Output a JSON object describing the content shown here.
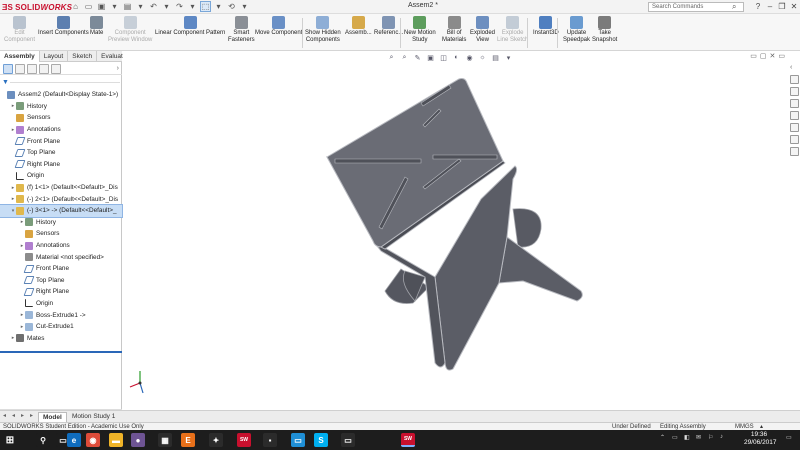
{
  "app": {
    "logo_ds": "ƎS",
    "logo_solid": "SOLID",
    "logo_works": "WORKS",
    "doc_title": "Assem2 *",
    "search_placeholder": "Search Commands",
    "window_buttons": [
      "?",
      "–",
      "❐",
      "✕"
    ]
  },
  "qat": [
    "⌂",
    "▭",
    "▣",
    "▾",
    "▤",
    "▾",
    "↶",
    "▾",
    "↷",
    "▾",
    "⬚",
    "▾",
    "⟲",
    "▾"
  ],
  "ribbon": {
    "buttons": [
      {
        "l1": "Edit",
        "l2": "Component",
        "color": "#b9c3cf",
        "dim": true
      },
      {
        "l1": "Insert Components",
        "l2": "",
        "color": "#5c7fb0",
        "dim": false
      },
      {
        "l1": "Mate",
        "l2": "",
        "color": "#7c8a99",
        "dim": false
      },
      {
        "l1": "Component",
        "l2": "Preview Window",
        "color": "#c7cfd8",
        "dim": true
      },
      {
        "l1": "Linear Component Pattern",
        "l2": "",
        "color": "#5e88c4",
        "dim": false
      },
      {
        "l1": "Smart",
        "l2": "Fasteners",
        "color": "#8a8f96",
        "dim": false
      },
      {
        "l1": "Move Component",
        "l2": "",
        "color": "#6a90c6",
        "dim": false
      },
      {
        "l1": "Show Hidden",
        "l2": "Components",
        "color": "#8eaed6",
        "dim": false
      },
      {
        "l1": "Assemb...",
        "l2": "",
        "color": "#d6a94a",
        "dim": false
      },
      {
        "l1": "Referenc...",
        "l2": "",
        "color": "#7f94b3",
        "dim": false
      },
      {
        "l1": "New Motion",
        "l2": "Study",
        "color": "#5d9d5d",
        "dim": false
      },
      {
        "l1": "Bill of",
        "l2": "Materials",
        "color": "#8b8b8b",
        "dim": false
      },
      {
        "l1": "Exploded",
        "l2": "View",
        "color": "#6d8fc0",
        "dim": false
      },
      {
        "l1": "Explode",
        "l2": "Line Sketch",
        "color": "#c3ccd6",
        "dim": true
      },
      {
        "l1": "Instant3D",
        "l2": "",
        "color": "#4f7fc0",
        "dim": false
      },
      {
        "l1": "Update",
        "l2": "Speedpak",
        "color": "#6a9bd0",
        "dim": false
      },
      {
        "l1": "Take",
        "l2": "Snapshot",
        "color": "#7b7b7b",
        "dim": false
      }
    ]
  },
  "panel": {
    "tabs": [
      "Assembly",
      "Layout",
      "Sketch",
      "Evaluate"
    ],
    "more": "›",
    "filter_icon": "▼",
    "tree": [
      {
        "label": "Assem2  (Default<Display State-1>)",
        "icon": "assy",
        "arrow": "",
        "indent": 0
      },
      {
        "label": "History",
        "icon": "hist",
        "arrow": "▸",
        "indent": 1
      },
      {
        "label": "Sensors",
        "icon": "sens",
        "arrow": "",
        "indent": 1
      },
      {
        "label": "Annotations",
        "icon": "anno",
        "arrow": "▸",
        "indent": 1
      },
      {
        "label": "Front Plane",
        "icon": "plane",
        "arrow": "",
        "indent": 1
      },
      {
        "label": "Top Plane",
        "icon": "plane",
        "arrow": "",
        "indent": 1
      },
      {
        "label": "Right Plane",
        "icon": "plane",
        "arrow": "",
        "indent": 1
      },
      {
        "label": "Origin",
        "icon": "orig",
        "arrow": "",
        "indent": 1
      },
      {
        "label": "(f) 1<1> (Default<<Default>_Dis",
        "icon": "part",
        "arrow": "▸",
        "indent": 1
      },
      {
        "label": "(-) 2<1> (Default<<Default>_Dis",
        "icon": "part",
        "arrow": "▸",
        "indent": 1
      },
      {
        "label": "(-) 3<1> -> (Default<<Default>_",
        "icon": "part",
        "arrow": "▾",
        "indent": 1,
        "selected": true
      },
      {
        "label": "History",
        "icon": "hist",
        "arrow": "▸",
        "indent": 2
      },
      {
        "label": "Sensors",
        "icon": "sens",
        "arrow": "",
        "indent": 2
      },
      {
        "label": "Annotations",
        "icon": "anno",
        "arrow": "▸",
        "indent": 2
      },
      {
        "label": "Material <not specified>",
        "icon": "mat",
        "arrow": "",
        "indent": 2
      },
      {
        "label": "Front Plane",
        "icon": "plane",
        "arrow": "",
        "indent": 2
      },
      {
        "label": "Top Plane",
        "icon": "plane",
        "arrow": "",
        "indent": 2
      },
      {
        "label": "Right Plane",
        "icon": "plane",
        "arrow": "",
        "indent": 2
      },
      {
        "label": "Origin",
        "icon": "orig",
        "arrow": "",
        "indent": 2
      },
      {
        "label": "Boss-Extrude1 ->",
        "icon": "feat",
        "arrow": "▸",
        "indent": 2
      },
      {
        "label": "Cut-Extrude1",
        "icon": "feat",
        "arrow": "▸",
        "indent": 2
      },
      {
        "label": "Mates",
        "icon": "mates",
        "arrow": "▸",
        "indent": 1
      }
    ]
  },
  "bottom_tabs": [
    "Model",
    "Motion Study 1"
  ],
  "scroll_arrows": [
    "◂",
    "▸"
  ],
  "viewport": {
    "heads_up": [
      "⌕",
      "⌕",
      "✎",
      "▣",
      "◫",
      "◐",
      "◉",
      "☼",
      "▤",
      "▾"
    ],
    "win_controls": [
      "▭",
      "▢",
      "✕",
      "▭"
    ],
    "tp_arrow": "‹",
    "bottom_right": [
      "!",
      "▾"
    ]
  },
  "status": {
    "left": "SOLIDWORKS Student Edition - Academic Use Only",
    "state": "Under Defined",
    "mode": "Editing Assembly",
    "units": "MMGS",
    "units_arrow": "▴"
  },
  "taskbar": {
    "start": "⊞",
    "apps": [
      {
        "name": "search-icon",
        "glyph": "⚲",
        "color": "#1d1d1d"
      },
      {
        "name": "task-view-icon",
        "glyph": "▭",
        "color": "#1d1d1d"
      },
      {
        "name": "edge-icon",
        "glyph": "e",
        "color": "#0f6cbd"
      },
      {
        "name": "chrome-icon",
        "glyph": "◉",
        "color": "#dd4b39"
      },
      {
        "name": "explorer-icon",
        "glyph": "▬",
        "color": "#f0b428"
      },
      {
        "name": "github-icon",
        "glyph": "●",
        "color": "#6e5494"
      },
      {
        "name": "photoshop-icon",
        "glyph": "▦",
        "color": "#2b2b2b"
      },
      {
        "name": "sketchup-icon",
        "glyph": "E",
        "color": "#e8701a"
      },
      {
        "name": "tool-icon",
        "glyph": "✦",
        "color": "#2b2b2b"
      },
      {
        "name": "solidworks-icon",
        "glyph": "SW",
        "color": "#c8102e"
      },
      {
        "name": "store-icon",
        "glyph": "▪",
        "color": "#2b2b2b"
      },
      {
        "name": "app-icon",
        "glyph": "▭",
        "color": "#1f8fd6"
      },
      {
        "name": "skype-icon",
        "glyph": "S",
        "color": "#00aff0"
      },
      {
        "name": "monitor-icon",
        "glyph": "▭",
        "color": "#2b2b2b"
      },
      {
        "name": "solidworks-active-icon",
        "glyph": "SW",
        "color": "#c8102e"
      }
    ],
    "tray": [
      "⌃",
      "▭",
      "◧",
      "✉",
      "⚐",
      "♪"
    ],
    "time": "19:36",
    "date": "29/06/2017",
    "notif": "▭"
  },
  "colors": {
    "model_face": "#5b5d66",
    "model_top": "#6a6c75",
    "model_edge": "#b8bac0",
    "accent": "#2a67b8"
  }
}
